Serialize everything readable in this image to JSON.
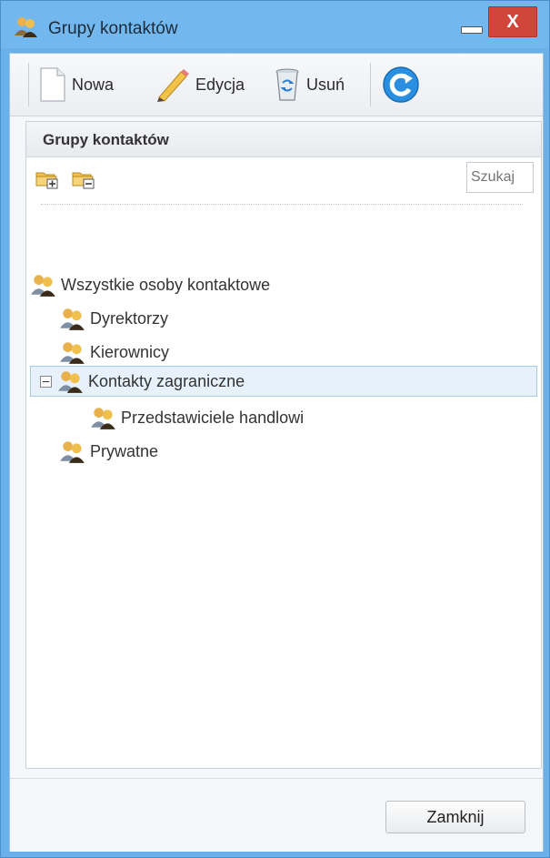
{
  "window": {
    "title": "Grupy kontaktów",
    "close_glyph": "X"
  },
  "toolbar": {
    "new_label": "Nowa",
    "edit_label": "Edycja",
    "delete_label": "Usuń"
  },
  "panel": {
    "title": "Grupy kontaktów",
    "search_placeholder": "Szukaj"
  },
  "tree": {
    "root": "Wszystkie osoby kontaktowe",
    "items": [
      "Dyrektorzy",
      "Kierownicy",
      "Kontakty zagraniczne",
      "Przedstawiciele handlowi",
      "Prywatne"
    ]
  },
  "footer": {
    "close_label": "Zamknij"
  },
  "colors": {
    "titlebar": "#72b8ee",
    "close": "#d0463b",
    "selection": "#e6f1fb"
  }
}
